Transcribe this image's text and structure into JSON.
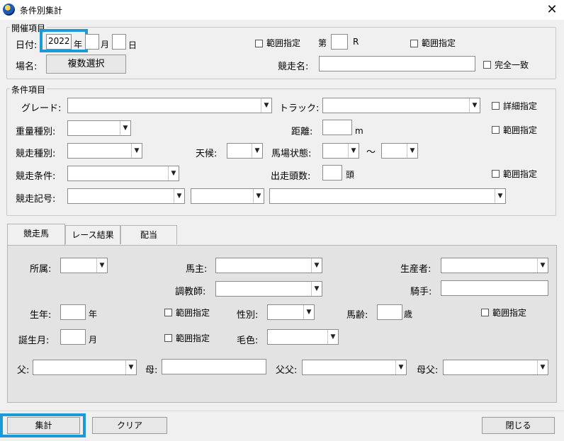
{
  "window": {
    "title": "条件別集計",
    "close": "✕"
  },
  "kaisai": {
    "legend": "開催項目",
    "date_label": "日付:",
    "year_value": "2022",
    "year_unit": "年",
    "month_value": "",
    "month_unit": "月",
    "day_value": "",
    "day_unit": "日",
    "range_label": "範囲指定",
    "dai_label": "第",
    "race_value": "",
    "race_unit": "R",
    "range2_label": "範囲指定",
    "venue_label": "場名:",
    "venue_button": "複数選択",
    "race_name_label": "競走名:",
    "race_name_value": "",
    "exact_label": "完全一致"
  },
  "joken": {
    "legend": "条件項目",
    "grade_label": "グレード:",
    "track_label": "トラック:",
    "detail_label": "詳細指定",
    "weight_label": "重量種別:",
    "distance_label": "距離:",
    "distance_value": "",
    "distance_unit": "m",
    "range_label": "範囲指定",
    "race_type_label": "競走種別:",
    "weather_label": "天候:",
    "going_label": "馬場状態:",
    "tilde": "〜",
    "race_cond_label": "競走条件:",
    "runners_label": "出走頭数:",
    "runners_value": "",
    "runners_unit": "頭",
    "range2_label": "範囲指定",
    "symbol_label": "競走記号:"
  },
  "tabs": [
    {
      "label": "競走馬"
    },
    {
      "label": "レース結果"
    },
    {
      "label": "配当"
    }
  ],
  "horse": {
    "affiliation_label": "所属:",
    "owner_label": "馬主:",
    "breeder_label": "生産者:",
    "trainer_label": "調教師:",
    "jockey_label": "騎手:",
    "jockey_value": "",
    "birth_year_label": "生年:",
    "birth_year_value": "",
    "birth_year_unit": "年",
    "range_label": "範囲指定",
    "sex_label": "性別:",
    "age_label": "馬齢:",
    "age_value": "",
    "age_unit": "歳",
    "range2_label": "範囲指定",
    "birth_month_label": "誕生月:",
    "birth_month_value": "",
    "birth_month_unit": "月",
    "range3_label": "範囲指定",
    "coat_label": "毛色:",
    "sire_label": "父:",
    "dam_label": "母:",
    "dam_value": "",
    "sire_sire_label": "父父:",
    "dam_sire_label": "母父:"
  },
  "footer": {
    "aggregate_button": "集計",
    "clear_button": "クリア",
    "close_button": "閉じる"
  },
  "icons": {
    "dropdown": "▼",
    "app": "globe-app-icon"
  },
  "colors": {
    "highlight": "#1b9ad6",
    "background": "#f0f0f0",
    "panel": "#e3e3e3"
  }
}
